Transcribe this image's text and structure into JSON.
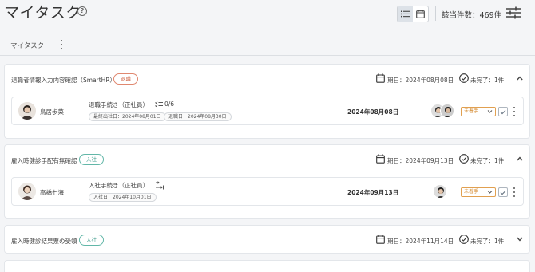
{
  "header": {
    "title": "マイタスク",
    "help_icon": "help-circle-icon",
    "view_list_icon": "list-view-icon",
    "view_calendar_icon": "calendar-view-icon",
    "count": "該当件数：469件",
    "filter_icon": "filter-sliders-icon"
  },
  "tabs": {
    "label": "マイタスク"
  },
  "groups": [
    {
      "title": "退職者情報入力内容確認（SmartHR）",
      "badge": "退職",
      "badge_color": "#d06a4c",
      "due": "期日：2024年08月08日",
      "status": "未完了：1件",
      "expanded": true,
      "task": {
        "assignee": "鳥居歩菜",
        "title": "退職手続き（正社員）",
        "progress": "0/6",
        "chip1": "最終出社日：2024年08月01日",
        "chip2": "退職日：2024年08月30日",
        "date": "2024年08月08日",
        "select": "未着手"
      }
    },
    {
      "title": "雇入時健診手配有無確認",
      "badge": "入社",
      "badge_color": "#3e9c8c",
      "due": "期日：2024年09月13日",
      "status": "未完了：1件",
      "expanded": true,
      "task": {
        "assignee": "高橋七海",
        "title": "入社手続き（正社員）",
        "chip1": "入社日：2024年10月01日",
        "date": "2024年09月13日",
        "select": "未着手"
      }
    },
    {
      "title": "雇入時健診結果票の受領",
      "badge": "入社",
      "badge_color": "#3e9c8c",
      "due": "期日：2024年11月14日",
      "status": "未完了：1件",
      "expanded": false
    }
  ]
}
